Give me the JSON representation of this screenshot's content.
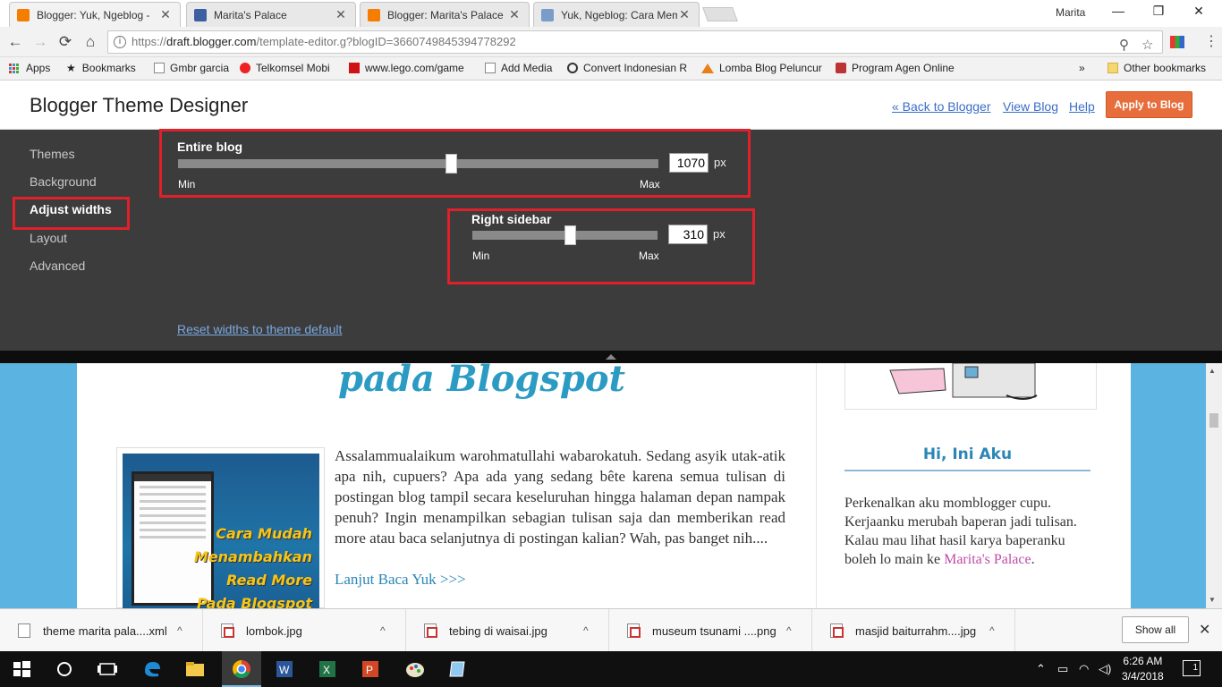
{
  "browser": {
    "tabs": [
      {
        "title": "Blogger: Yuk, Ngeblog -",
        "icon": "blogger-icon",
        "color": "#f57d00",
        "active": true
      },
      {
        "title": "Marita's Palace",
        "icon": "blog-m-icon",
        "color": "#3b5fa0",
        "active": false
      },
      {
        "title": "Blogger: Marita's Palace",
        "icon": "blogger-icon",
        "color": "#f57d00",
        "active": false
      },
      {
        "title": "Yuk, Ngeblog: Cara Mem",
        "icon": "pen-icon",
        "color": "#7a9cc8",
        "active": false
      }
    ],
    "close_glyph": "✕",
    "profile_name": "Marita",
    "window_min": "—",
    "window_max": "❐",
    "window_close": "✕",
    "nav": {
      "back": "←",
      "forward": "→",
      "reload": "⟳",
      "home": "⌂"
    },
    "url_scheme": "https://",
    "url_host": "draft.blogger.com",
    "url_path": "/template-editor.g?blogID=3660749845394778292",
    "info_glyph": "i",
    "zoom_glyph": "⚲",
    "star_glyph": "☆",
    "menu_glyph": "⋮"
  },
  "bookmarks": {
    "apps_label": "Apps",
    "items": [
      {
        "label": "Bookmarks",
        "icon": "star-icon"
      },
      {
        "label": "Gmbr garcia",
        "icon": "page-icon"
      },
      {
        "label": "Telkomsel Mobi",
        "icon": "telkomsel-icon"
      },
      {
        "label": "www.lego.com/game",
        "icon": "lego-icon"
      },
      {
        "label": "Add Media",
        "icon": "page-icon"
      },
      {
        "label": "Convert Indonesian R",
        "icon": "convert-icon"
      },
      {
        "label": "Lomba Blog Peluncur",
        "icon": "mountain-icon"
      },
      {
        "label": "Program Agen Online",
        "icon": "agent-icon"
      }
    ],
    "overflow": "»",
    "other": "Other bookmarks"
  },
  "designer": {
    "title": "Blogger Theme Designer",
    "back_link": "« Back to Blogger",
    "view_link": "View Blog",
    "help_link": "Help",
    "apply_button": "Apply to Blog",
    "accent_color": "#e76e3c"
  },
  "sidebar_nav": {
    "items": [
      "Themes",
      "Background",
      "Adjust widths",
      "Layout",
      "Advanced"
    ],
    "active": "Adjust widths"
  },
  "widths": {
    "entire_blog": {
      "label": "Entire blog",
      "value": "1070",
      "unit": "px",
      "min": "Min",
      "max": "Max",
      "position": 0.57
    },
    "right_sidebar": {
      "label": "Right sidebar",
      "value": "310",
      "unit": "px",
      "min": "Min",
      "max": "Max",
      "position": 0.52
    },
    "reset_link": "Reset widths to theme default",
    "highlight_color": "#e0202a"
  },
  "preview": {
    "post_title_fragment": "pada Blogspot",
    "thumb_lines": [
      "Cara Mudah",
      "Menambahkan",
      "Read More",
      "Pada Blogspot"
    ],
    "post_excerpt": "Assalammualaikum warohmatullahi wabarokatuh. Sedang asyik utak-atik apa nih, cupuers? Apa ada yang sedang bête karena semua tulisan di postingan blog tampil secara keseluruhan hingga halaman depan nampak penuh? Ingin menampilkan sebagian tulisan saja dan memberikan read more atau baca selanjutnya di postingan kalian? Wah, pas banget nih....",
    "read_more": "Lanjut Baca Yuk >>>",
    "gadget_title": "Hi, Ini Aku",
    "gadget_text": "Perkenalkan aku momblogger cupu. Kerjaanku merubah baperan jadi tulisan. Kalau mau lihat hasil karya baperanku boleh lo main ke ",
    "gadget_link": "Marita's Palace",
    "gadget_end": ".",
    "background_color": "#5ab3e1"
  },
  "downloads": {
    "items": [
      {
        "name": "theme marita pala....xml",
        "type": "file"
      },
      {
        "name": "lombok.jpg",
        "type": "image"
      },
      {
        "name": "tebing di waisai.jpg",
        "type": "image"
      },
      {
        "name": "museum tsunami ....png",
        "type": "image"
      },
      {
        "name": "masjid baiturrahm....jpg",
        "type": "image"
      }
    ],
    "chevron": "^",
    "show_all": "Show all",
    "close": "✕"
  },
  "taskbar": {
    "time": "6:26 AM",
    "date": "3/4/2018",
    "notification_count": "1",
    "apps": [
      "start-icon",
      "cortana-icon",
      "task-view-icon",
      "edge-icon",
      "file-explorer-icon",
      "chrome-icon",
      "word-icon",
      "excel-icon",
      "powerpoint-icon",
      "paint-icon",
      "notepad-icon"
    ]
  }
}
